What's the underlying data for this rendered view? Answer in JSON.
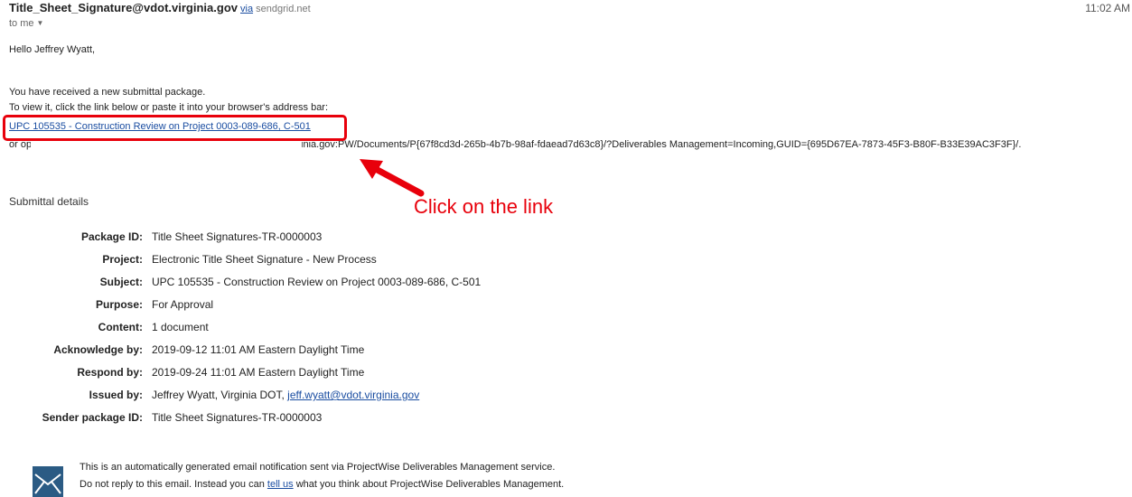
{
  "header": {
    "sender": "Title_Sheet_Signature@vdot.virginia.gov",
    "via_word": "via",
    "via_domain": "sendgrid.net",
    "time": "11:02 AM",
    "to_me": "to me"
  },
  "body": {
    "greeting": "Hello Jeffrey Wyatt,",
    "received": "You have received a new submittal package.",
    "view_instructions": "To view it, click the link below or paste it into your browser's address bar:",
    "package_link": "UPC 105535 - Construction Review on Project 0003-089-686, C-501",
    "guid_line": "or open this link in ProjectWise Explorer: pw://IN4PP1113.vdot.virginia.gov:PW/Documents/P{67f8cd3d-265b-4b7b-98af-fdaead7d63c8}/?Deliverables Management=Incoming,GUID={695D67EA-7873-45F3-B80F-B33E39AC3F3F}/."
  },
  "annotation": {
    "callout": "Click on the link",
    "color": "#e8000b"
  },
  "details": {
    "section_title": "Submittal details",
    "rows": [
      {
        "label": "Package ID",
        "value": "Title Sheet Signatures-TR-0000003"
      },
      {
        "label": "Project",
        "value": "Electronic Title Sheet Signature - New Process"
      },
      {
        "label": "Subject",
        "value": "UPC 105535 - Construction Review on Project 0003-089-686, C-501"
      },
      {
        "label": "Purpose",
        "value": "For Approval"
      },
      {
        "label": "Content",
        "value": "1 document"
      },
      {
        "label": "Acknowledge by",
        "value": "2019-09-12 11:01 AM Eastern Daylight Time"
      },
      {
        "label": "Respond by",
        "value": "2019-09-24 11:01 AM Eastern Daylight Time"
      },
      {
        "label": "Issued by",
        "value": "Jeffrey Wyatt, Virginia DOT, ",
        "link": "jeff.wyatt@vdot.virginia.gov"
      },
      {
        "label": "Sender package ID",
        "value": "Title Sheet Signatures-TR-0000003"
      }
    ]
  },
  "footer": {
    "line1": "This is an automatically generated email notification sent via ProjectWise Deliverables Management service.",
    "line2_pre": "Do not reply to this email. Instead you can ",
    "line2_link": "tell us",
    "line2_post": " what you think about ProjectWise Deliverables Management."
  },
  "icons": {
    "logo": "envelope-logo-icon",
    "caret": "caret-down-icon",
    "arrow": "red-arrow-icon"
  },
  "colors": {
    "link": "#1a4da1",
    "accent_red": "#e8000b",
    "logo_bg": "#2b5b84"
  }
}
